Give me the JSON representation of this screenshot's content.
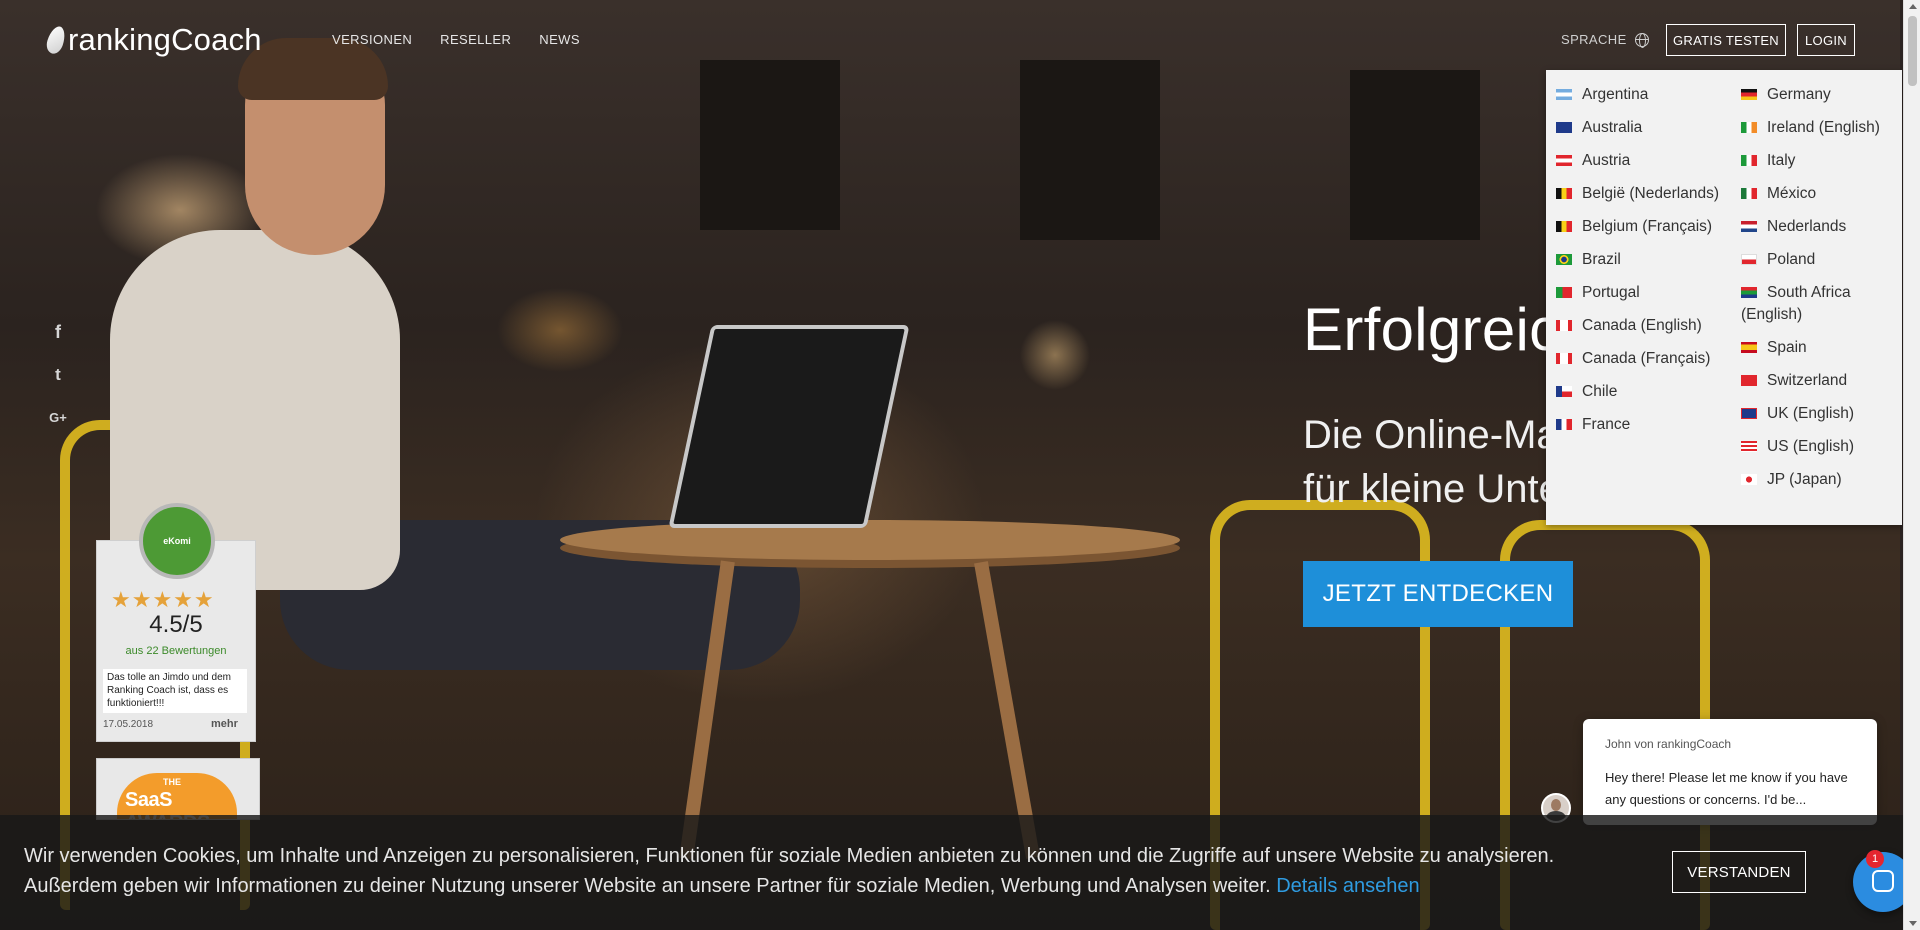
{
  "header": {
    "logo_text": "rankingCoach",
    "nav": [
      "VERSIONEN",
      "RESELLER",
      "NEWS"
    ],
    "language_label": "SPRACHE",
    "trial_button": "GRATIS TESTEN",
    "login_button": "LOGIN"
  },
  "language_dropdown": {
    "left": [
      {
        "label": "Argentina",
        "flag": "argentina-flag"
      },
      {
        "label": "Australia",
        "flag": "australia-flag"
      },
      {
        "label": "Austria",
        "flag": "austria-flag"
      },
      {
        "label": "België (Nederlands)",
        "flag": "belgium-flag"
      },
      {
        "label": "Belgium (Français)",
        "flag": "belgium-flag"
      },
      {
        "label": "Brazil",
        "flag": "brazil-flag"
      },
      {
        "label": "Portugal",
        "flag": "portugal-flag"
      },
      {
        "label": "Canada (English)",
        "flag": "canada-flag"
      },
      {
        "label": "Canada (Français)",
        "flag": "canada-flag"
      },
      {
        "label": "Chile",
        "flag": "chile-flag"
      },
      {
        "label": "France",
        "flag": "france-flag"
      }
    ],
    "right": [
      {
        "label": "Germany",
        "flag": "germany-flag"
      },
      {
        "label": "Ireland (English)",
        "flag": "ireland-flag"
      },
      {
        "label": "Italy",
        "flag": "italy-flag"
      },
      {
        "label": "México",
        "flag": "mexico-flag"
      },
      {
        "label": "Nederlands",
        "flag": "netherlands-flag"
      },
      {
        "label": "Poland",
        "flag": "poland-flag"
      },
      {
        "label": "South Africa (English)",
        "flag": "south-africa-flag"
      },
      {
        "label": "Spain",
        "flag": "spain-flag"
      },
      {
        "label": "Switzerland",
        "flag": "switzerland-flag"
      },
      {
        "label": "UK (English)",
        "flag": "uk-flag"
      },
      {
        "label": "US (English)",
        "flag": "us-flag"
      },
      {
        "label": "JP (Japan)",
        "flag": "japan-flag"
      }
    ]
  },
  "hero": {
    "headline": "Erfolgreich im Web",
    "subline_1": "Die Online-Marketing App",
    "subline_2": "für kleine Unternehmen",
    "cta": "JETZT ENTDECKEN"
  },
  "social": [
    "facebook-icon",
    "twitter-icon",
    "google-plus-icon"
  ],
  "ekomi": {
    "seal_text": "eKomi",
    "stars": "★★★★★",
    "score": "4.5/5",
    "count": "aus 22 Bewertungen",
    "quote": "Das tolle an Jimdo und dem Ranking Coach ist, dass es funktioniert!!!",
    "date": "17.05.2018",
    "more": "mehr"
  },
  "saas_award": {
    "the": "THE",
    "title": "SaaS AWARDS"
  },
  "chat": {
    "name": "John von rankingCoach",
    "message": "Hey there! Please let me know if you have any questions or concerns. I'd be...",
    "badge": "1"
  },
  "cookie": {
    "text": "Wir verwenden Cookies, um Inhalte und Anzeigen zu personalisieren, Funktionen für soziale Medien anbieten zu können und die Zugriffe auf unsere Website zu analysieren. Außerdem geben wir Informationen zu deiner Nutzung unserer Website an unsere Partner für soziale Medien, Werbung und Analysen weiter.",
    "link": "Details ansehen",
    "button": "VERSTANDEN"
  },
  "colors": {
    "accent": "#1e8fd9",
    "chair": "#d8b51f",
    "link": "#2f9be0"
  }
}
